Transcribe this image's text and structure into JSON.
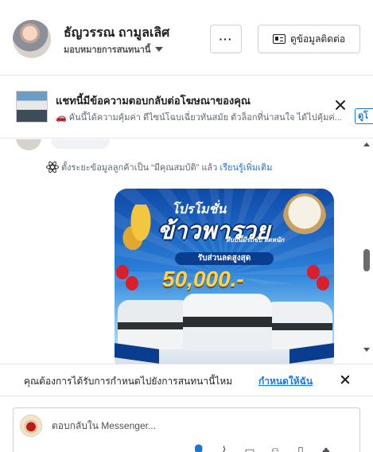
{
  "header": {
    "name": "ธัญวรรณ ถามูลเลิศ",
    "assign_label": "มอบหมายการสนทนานี้",
    "more_label": "···",
    "contact_label": "ดูข้อมูลติดต่อ"
  },
  "ad_banner": {
    "title": "แชทนี้มีข้อความตอบกลับต่อโฆษณาของคุณ",
    "subtitle": "🚗 คันนี้ได้ความคุ้มค่า ดีไซน์โฉบเฉี่ยวทันสมัย ตัวล็อกที่น่าสนใจ ได้ไปคุ้มค่...",
    "peek_label": "ดูโ"
  },
  "system_note": {
    "text": "ตั้งระยะข้อมูลลูกค้าเป็น “มีคุณสมบัติ” แล้ว",
    "link": "เรียนรู้เพิ่มเติม"
  },
  "ad_image": {
    "promo_small": "โปรโมชั่น",
    "promo_big": "ข้าวพารวย",
    "promo_tag": "สืบปีนี้มีรถขับ ลดหนัก",
    "promo_discount": "รับส่วนลดสูงสุด",
    "promo_amount": "50,000.-"
  },
  "reminder": {
    "text": "คุณต้องการได้รับการกำหนดไปยังการสนทนานี้ไหม",
    "link": "กำหนดให้ฉัน"
  },
  "composer": {
    "placeholder": "ตอบกลับใน Messenger..."
  },
  "colors": {
    "accent": "#1877f2",
    "border": "#ccd0d5",
    "text": "#1c1e21"
  }
}
